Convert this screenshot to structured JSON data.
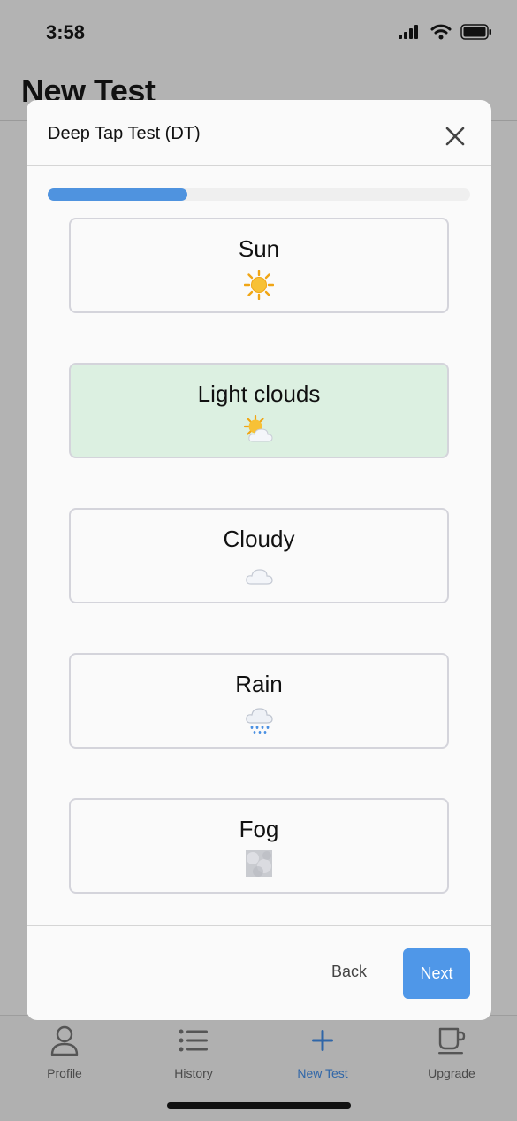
{
  "status_bar": {
    "time": "3:58"
  },
  "page": {
    "title": "New Test"
  },
  "modal": {
    "title": "Deep Tap Test (DT)",
    "progress": 0.33,
    "options": [
      {
        "label": "Sun",
        "icon": "sun-icon",
        "selected": false
      },
      {
        "label": "Light clouds",
        "icon": "sun-behind-cloud-icon",
        "selected": true
      },
      {
        "label": "Cloudy",
        "icon": "cloud-icon",
        "selected": false
      },
      {
        "label": "Rain",
        "icon": "rain-cloud-icon",
        "selected": false
      },
      {
        "label": "Fog",
        "icon": "fog-icon",
        "selected": false
      }
    ],
    "back_label": "Back",
    "next_label": "Next"
  },
  "tabbar": {
    "tabs": [
      {
        "label": "Profile",
        "icon": "person-icon",
        "active": false
      },
      {
        "label": "History",
        "icon": "list-icon",
        "active": false
      },
      {
        "label": "New Test",
        "icon": "plus-icon",
        "active": true
      },
      {
        "label": "Upgrade",
        "icon": "coffee-cup-icon",
        "active": false
      }
    ]
  },
  "colors": {
    "accent": "#4f97e8",
    "selected_option": "#dcf0e1",
    "active_tab": "#2f66a8"
  }
}
